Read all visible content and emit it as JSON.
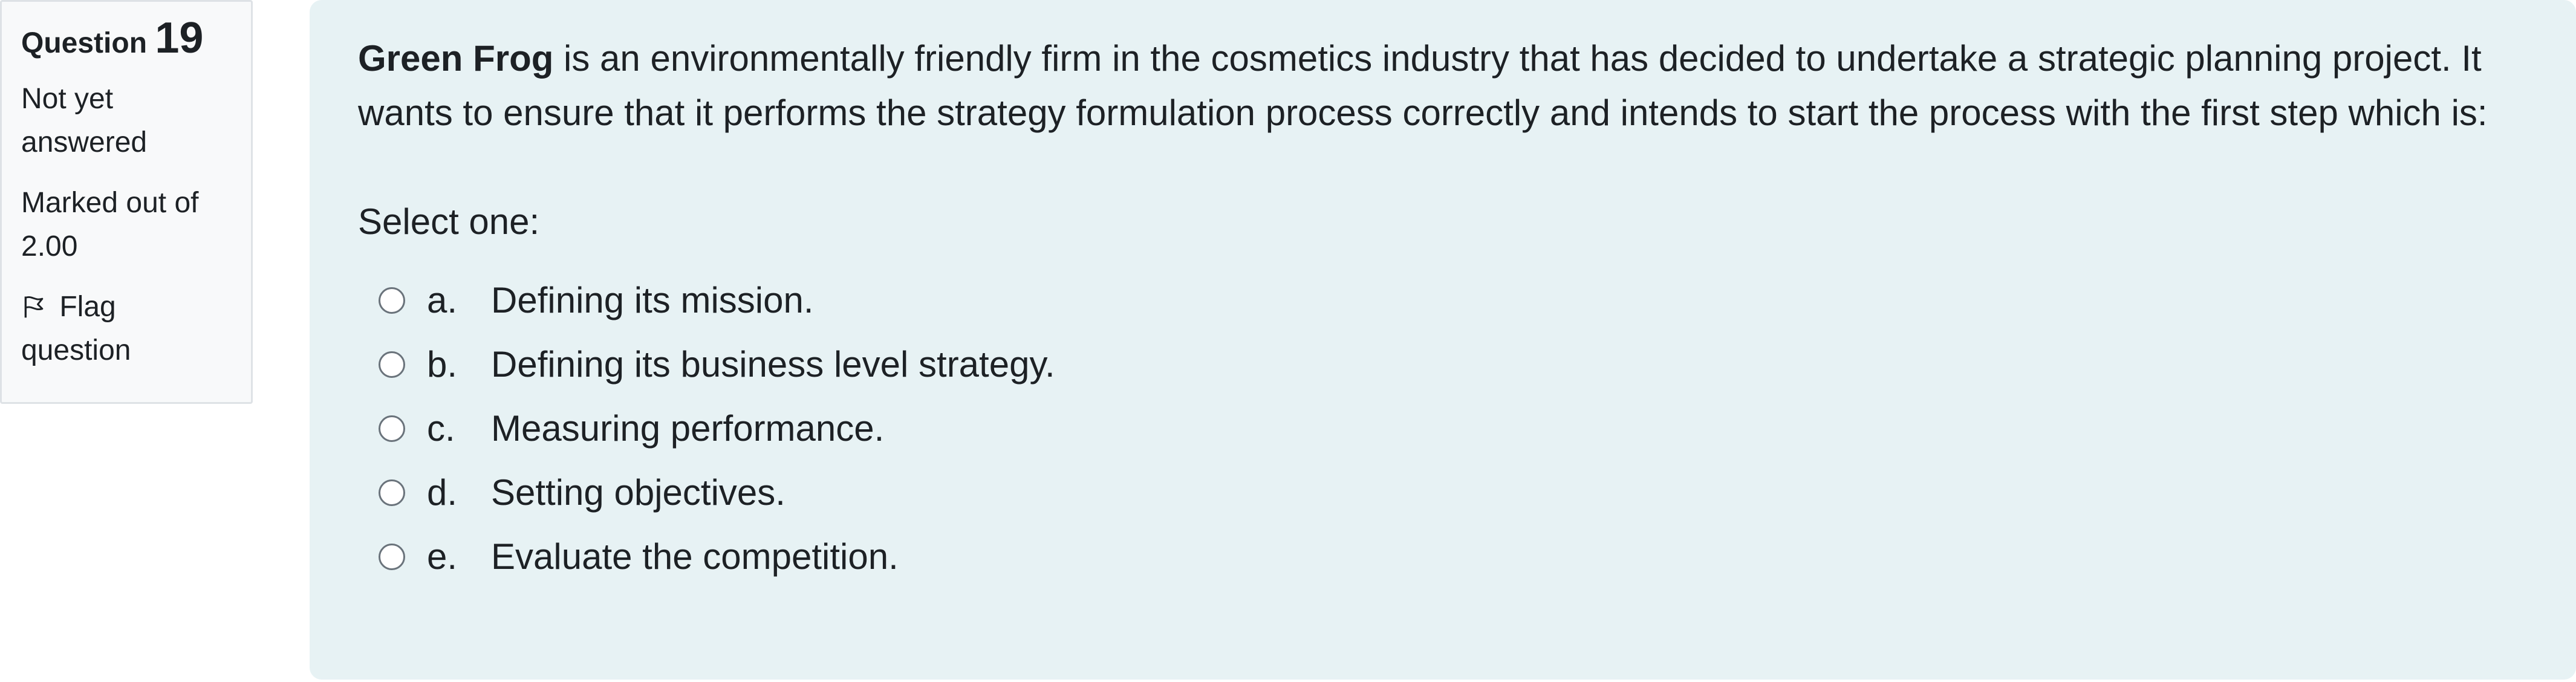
{
  "info": {
    "question_label": "Question",
    "question_number": "19",
    "state": "Not yet answered",
    "grade": "Marked out of 2.00",
    "flag_label": "Flag question"
  },
  "question": {
    "company": "Green Frog",
    "text_rest": " is an environmentally friendly firm in the cosmetics industry that has decided to undertake a strategic planning project. It wants to ensure that it performs the strategy formulation process correctly and intends to start the process with the first step which is:",
    "prompt": "Select one:",
    "options": [
      {
        "letter": "a.",
        "text": "Defining its mission."
      },
      {
        "letter": "b.",
        "text": "Defining its business level strategy."
      },
      {
        "letter": "c.",
        "text": "Measuring performance."
      },
      {
        "letter": "d.",
        "text": "Setting objectives."
      },
      {
        "letter": "e.",
        "text": "Evaluate the competition."
      }
    ]
  },
  "colors": {
    "content_bg": "#e7f2f4",
    "info_bg": "#f8f9fa",
    "info_border": "#dee2e6",
    "text": "#1d2125"
  },
  "icons": {
    "flag": "flag-icon"
  }
}
